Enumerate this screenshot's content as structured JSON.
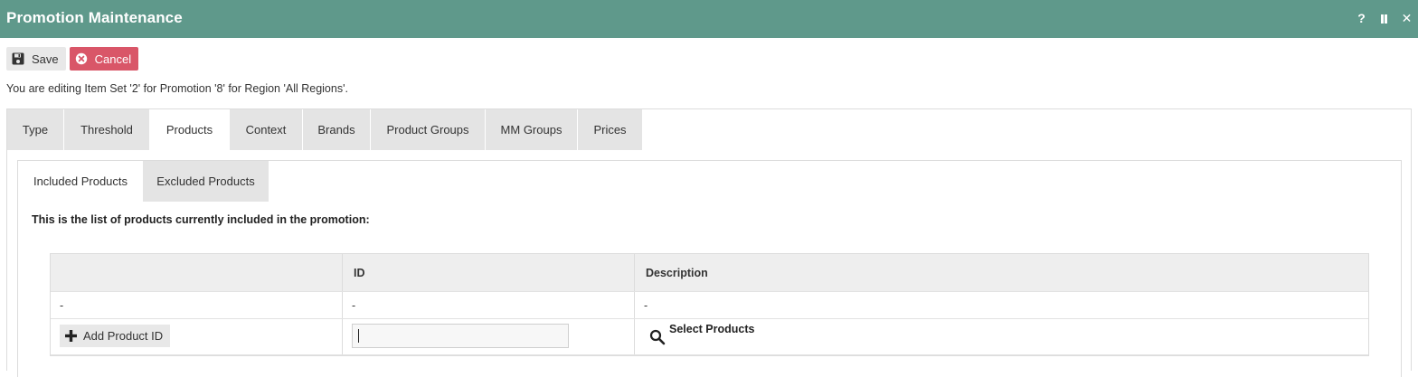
{
  "window": {
    "title": "Promotion Maintenance",
    "help_glyph": "?",
    "close_glyph": "✕"
  },
  "toolbar": {
    "save_label": "Save",
    "cancel_label": "Cancel"
  },
  "edit_message": "You are editing Item Set '2' for Promotion '8' for Region 'All Regions'.",
  "tabs": [
    {
      "label": "Type"
    },
    {
      "label": "Threshold"
    },
    {
      "label": "Products"
    },
    {
      "label": "Context"
    },
    {
      "label": "Brands"
    },
    {
      "label": "Product Groups"
    },
    {
      "label": "MM Groups"
    },
    {
      "label": "Prices"
    }
  ],
  "subtabs": [
    {
      "label": "Included Products"
    },
    {
      "label": "Excluded Products"
    }
  ],
  "list_heading": "This is the list of products currently included in the promotion:",
  "table": {
    "columns": [
      "",
      "ID",
      "Description"
    ],
    "rows": [
      [
        "-",
        "-",
        "-"
      ]
    ],
    "add_button_label": "Add Product ID",
    "id_input_value": "",
    "select_products_label": "Select Products"
  },
  "colors": {
    "titlebar": "#5f998b",
    "cancel": "#d95668"
  }
}
